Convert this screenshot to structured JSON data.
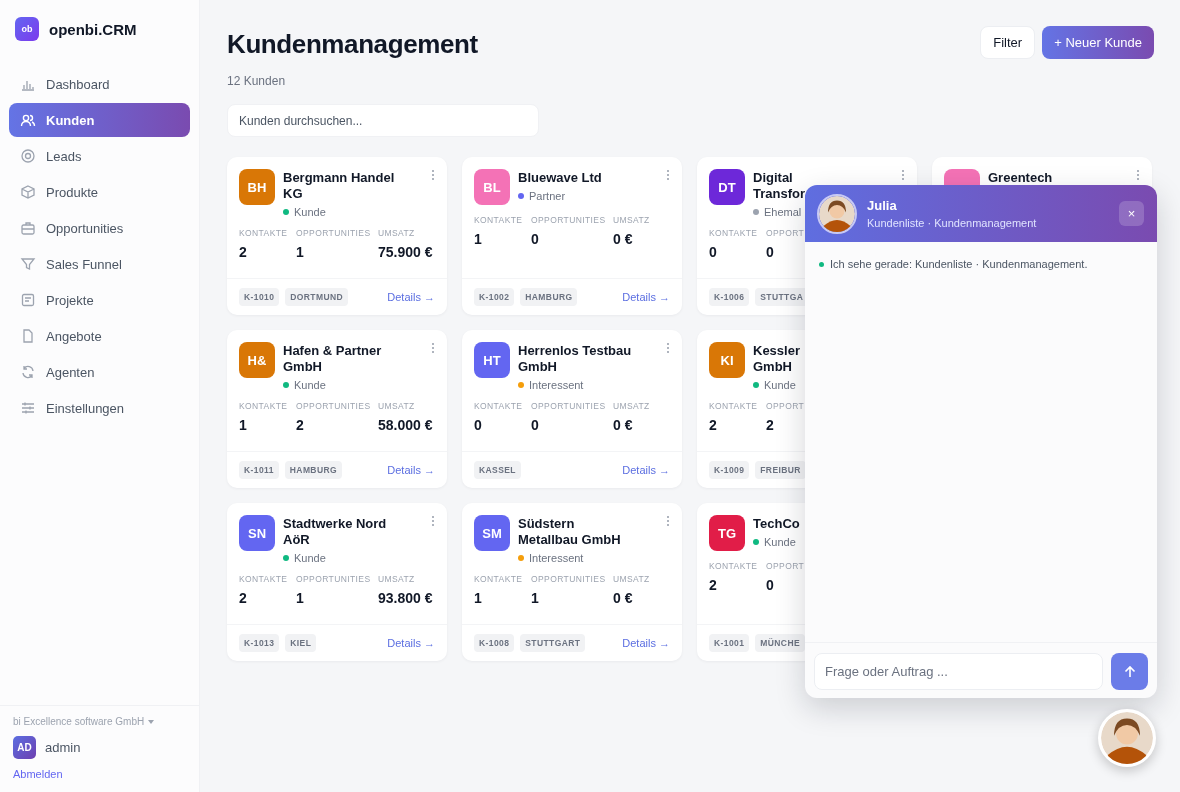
{
  "brand": {
    "logo": "ob",
    "name": "openbi.CRM"
  },
  "nav": [
    {
      "label": "Dashboard",
      "selected": false
    },
    {
      "label": "Kunden",
      "selected": true
    },
    {
      "label": "Leads",
      "selected": false
    },
    {
      "label": "Produkte",
      "selected": false
    },
    {
      "label": "Opportunities",
      "selected": false
    },
    {
      "label": "Sales Funnel",
      "selected": false
    },
    {
      "label": "Projekte",
      "selected": false
    },
    {
      "label": "Angebote",
      "selected": false
    },
    {
      "label": "Agenten",
      "selected": false
    },
    {
      "label": "Einstellungen",
      "selected": false
    }
  ],
  "account": {
    "company": "bi Excellence software GmbH",
    "user_initials": "AD",
    "user": "admin",
    "logout": "Abmelden"
  },
  "header": {
    "title": "Kundenmanagement",
    "count": "12 Kunden",
    "buttons": [
      "Filter",
      "+ Neuer Kunde"
    ],
    "search": {
      "placeholder": "Kunden durchsuchen..."
    }
  },
  "cards": [
    {
      "initials": "BH",
      "color": "#d97706",
      "name": "Bergmann Handel KG",
      "status": {
        "label": "Kunde",
        "color": "#10b981"
      },
      "stats": [
        {
          "label": "KONTAKTE",
          "value": "2"
        },
        {
          "label": "OPPORTUNITIES",
          "value": "1"
        },
        {
          "label": "UMSATZ",
          "value": "75.900 €"
        }
      ],
      "tags": [
        "K-1010",
        "DORTMUND"
      ],
      "link": "Details →"
    },
    {
      "initials": "BL",
      "color": "#f472b6",
      "name": "Bluewave Ltd",
      "status": {
        "label": "Partner",
        "color": "#6366f1"
      },
      "stats": [
        {
          "label": "KONTAKTE",
          "value": "1"
        },
        {
          "label": "OPPORTUNITIES",
          "value": "0"
        },
        {
          "label": "UMSATZ",
          "value": "0 €"
        }
      ],
      "tags": [
        "K-1002",
        "HAMBURG"
      ],
      "link": "Details →"
    },
    {
      "initials": "DT",
      "color": "#6d28d9",
      "name": "Digital\nTransfor",
      "status": {
        "label": "Ehemal",
        "color": "#9ca3af"
      },
      "stats": [
        {
          "label": "KONTAKTE",
          "value": "0"
        },
        {
          "label": "OPPORT",
          "value": "0"
        }
      ],
      "tags": [
        "K-1006",
        "STUTTGA"
      ]
    },
    {
      "color": "#f472b6",
      "name": "Greentech"
    },
    {
      "initials": "H&",
      "color": "#d97706",
      "name": "Hafen & Partner GmbH",
      "status": {
        "label": "Kunde",
        "color": "#10b981"
      },
      "stats": [
        {
          "label": "KONTAKTE",
          "value": "1"
        },
        {
          "label": "OPPORTUNITIES",
          "value": "2"
        },
        {
          "label": "UMSATZ",
          "value": "58.000 €"
        }
      ],
      "tags": [
        "K-1011",
        "HAMBURG"
      ],
      "link": "Details →"
    },
    {
      "initials": "HT",
      "color": "#6366f1",
      "name": "Herrenlos Testbau GmbH",
      "status": {
        "label": "Interessent",
        "color": "#f59e0b"
      },
      "stats": [
        {
          "label": "KONTAKTE",
          "value": "0"
        },
        {
          "label": "OPPORTUNITIES",
          "value": "0"
        },
        {
          "label": "UMSATZ",
          "value": "0 €"
        }
      ],
      "tags": [
        "KASSEL"
      ],
      "link": "Details →"
    },
    {
      "initials": "KI",
      "color": "#d97706",
      "name": "Kessler\nGmbH",
      "status": {
        "label": "Kunde",
        "color": "#10b981"
      },
      "stats": [
        {
          "label": "KONTAKTE",
          "value": "2"
        },
        {
          "label": "OPPORT",
          "value": "2"
        }
      ],
      "tags": [
        "K-1009",
        "FREIBUR"
      ]
    },
    {
      "initials": "SN",
      "color": "#6366f1",
      "name": "Stadtwerke Nord AöR",
      "status": {
        "label": "Kunde",
        "color": "#10b981"
      },
      "stats": [
        {
          "label": "KONTAKTE",
          "value": "2"
        },
        {
          "label": "OPPORTUNITIES",
          "value": "1"
        },
        {
          "label": "UMSATZ",
          "value": "93.800 €"
        }
      ],
      "tags": [
        "K-1013",
        "KIEL"
      ],
      "link": "Details →"
    },
    {
      "initials": "SM",
      "color": "#6366f1",
      "name": "Südstern Metallbau GmbH",
      "status": {
        "label": "Interessent",
        "color": "#f59e0b"
      },
      "stats": [
        {
          "label": "KONTAKTE",
          "value": "1"
        },
        {
          "label": "OPPORTUNITIES",
          "value": "1"
        },
        {
          "label": "UMSATZ",
          "value": "0 €"
        }
      ],
      "tags": [
        "K-1008",
        "STUTTGART"
      ],
      "link": "Details →"
    },
    {
      "initials": "TG",
      "color": "#e11d48",
      "name": "TechCo",
      "status": {
        "label": "Kunde",
        "color": "#10b981"
      },
      "stats": [
        {
          "label": "KONTAKTE",
          "value": "2"
        },
        {
          "label": "OPPORT",
          "value": "0"
        }
      ],
      "tags": [
        "K-1001",
        "MÜNCHE"
      ]
    }
  ],
  "assistant": {
    "name": "Julia",
    "context": "Kundenliste · Kundenmanagement",
    "close": "×",
    "messages": [
      {
        "text": "Ich sehe gerade: Kundenliste · Kundenmanagement.",
        "color": "#10b981"
      }
    ],
    "input": {
      "placeholder": "Frage oder Auftrag ..."
    }
  }
}
